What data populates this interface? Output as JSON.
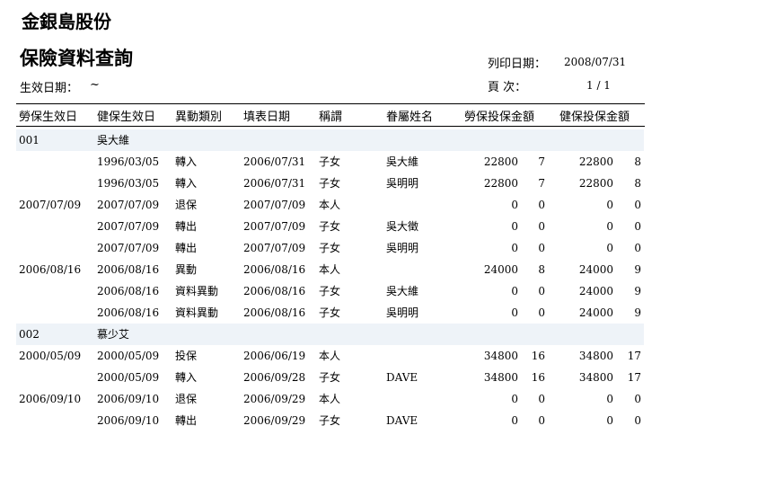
{
  "header": {
    "company": "金銀島股份",
    "title": "保險資料查詢",
    "effective_label": "生效日期：",
    "effective_value": "~",
    "print_date_label": "列印日期：",
    "print_date_value": "2008/07/31",
    "page_label": "頁 次：",
    "page_value": "1 / 1"
  },
  "columns": [
    "勞保生效日",
    "健保生效日",
    "異動類別",
    "填表日期",
    "稱謂",
    "眷屬姓名",
    "勞保投保金額",
    "健保投保金額"
  ],
  "groups": [
    {
      "id": "001",
      "name": "吳大維",
      "rows": [
        {
          "labor_date": "",
          "health_date": "1996/03/05",
          "type": "轉入",
          "fill_date": "2006/07/31",
          "relation": "子女",
          "dependent": "吳大維",
          "labor_amt": "22800",
          "labor_grade": "7",
          "health_amt": "22800",
          "health_grade": "8"
        },
        {
          "labor_date": "",
          "health_date": "1996/03/05",
          "type": "轉入",
          "fill_date": "2006/07/31",
          "relation": "子女",
          "dependent": "吳明明",
          "labor_amt": "22800",
          "labor_grade": "7",
          "health_amt": "22800",
          "health_grade": "8"
        },
        {
          "labor_date": "2007/07/09",
          "health_date": "2007/07/09",
          "type": "退保",
          "fill_date": "2007/07/09",
          "relation": "本人",
          "dependent": "",
          "labor_amt": "0",
          "labor_grade": "0",
          "health_amt": "0",
          "health_grade": "0"
        },
        {
          "labor_date": "",
          "health_date": "2007/07/09",
          "type": "轉出",
          "fill_date": "2007/07/09",
          "relation": "子女",
          "dependent": "吳大徵",
          "labor_amt": "0",
          "labor_grade": "0",
          "health_amt": "0",
          "health_grade": "0"
        },
        {
          "labor_date": "",
          "health_date": "2007/07/09",
          "type": "轉出",
          "fill_date": "2007/07/09",
          "relation": "子女",
          "dependent": "吳明明",
          "labor_amt": "0",
          "labor_grade": "0",
          "health_amt": "0",
          "health_grade": "0"
        },
        {
          "labor_date": "2006/08/16",
          "health_date": "2006/08/16",
          "type": "異動",
          "fill_date": "2006/08/16",
          "relation": "本人",
          "dependent": "",
          "labor_amt": "24000",
          "labor_grade": "8",
          "health_amt": "24000",
          "health_grade": "9"
        },
        {
          "labor_date": "",
          "health_date": "2006/08/16",
          "type": "資料異動",
          "fill_date": "2006/08/16",
          "relation": "子女",
          "dependent": "吳大維",
          "labor_amt": "0",
          "labor_grade": "0",
          "health_amt": "24000",
          "health_grade": "9"
        },
        {
          "labor_date": "",
          "health_date": "2006/08/16",
          "type": "資料異動",
          "fill_date": "2006/08/16",
          "relation": "子女",
          "dependent": "吳明明",
          "labor_amt": "0",
          "labor_grade": "0",
          "health_amt": "24000",
          "health_grade": "9"
        }
      ]
    },
    {
      "id": "002",
      "name": "慕少艾",
      "rows": [
        {
          "labor_date": "2000/05/09",
          "health_date": "2000/05/09",
          "type": "投保",
          "fill_date": "2006/06/19",
          "relation": "本人",
          "dependent": "",
          "labor_amt": "34800",
          "labor_grade": "16",
          "health_amt": "34800",
          "health_grade": "17"
        },
        {
          "labor_date": "",
          "health_date": "2000/05/09",
          "type": "轉入",
          "fill_date": "2006/09/28",
          "relation": "子女",
          "dependent": "DAVE",
          "labor_amt": "34800",
          "labor_grade": "16",
          "health_amt": "34800",
          "health_grade": "17"
        },
        {
          "labor_date": "2006/09/10",
          "health_date": "2006/09/10",
          "type": "退保",
          "fill_date": "2006/09/29",
          "relation": "本人",
          "dependent": "",
          "labor_amt": "0",
          "labor_grade": "0",
          "health_amt": "0",
          "health_grade": "0"
        },
        {
          "labor_date": "",
          "health_date": "2006/09/10",
          "type": "轉出",
          "fill_date": "2006/09/29",
          "relation": "子女",
          "dependent": "DAVE",
          "labor_amt": "0",
          "labor_grade": "0",
          "health_amt": "0",
          "health_grade": "0"
        }
      ]
    }
  ]
}
